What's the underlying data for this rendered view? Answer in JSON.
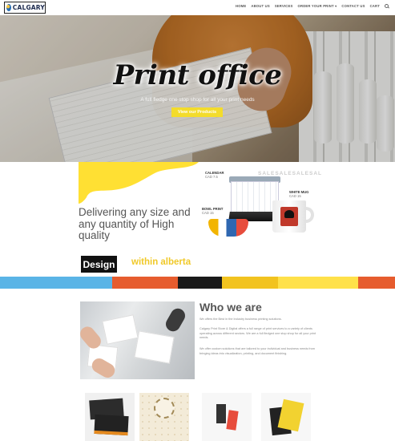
{
  "header": {
    "logo_text": "CALGARY",
    "nav": [
      "HOME",
      "ABOUT US",
      "SERVICES",
      "ORDER YOUR PRINT ▾",
      "CONTACT US",
      "CART"
    ]
  },
  "hero": {
    "title": "Print office",
    "subtitle": "A full fledge one stop shop for all your print needs",
    "button": "View our Products"
  },
  "promo": {
    "heading": "Delivering any size and any quantity of High quality",
    "marquee": "SALESALESALESAL",
    "products": [
      {
        "name": "CALENDAR",
        "price": "CAD 7.5"
      },
      {
        "name": "WHITE MUG",
        "price": "CAD 15"
      },
      {
        "name": "BOWL PRINT",
        "price": "CAD 15"
      }
    ],
    "design_label": "Design",
    "within_label": "within alberta"
  },
  "band_colors": [
    "#5ab4e6",
    "#e65c2e",
    "#1a1a1a",
    "#f2c31f",
    "#ffe14a",
    "#e65c2e"
  ],
  "about": {
    "title": "Who we are",
    "p1": "We offers the Best in the Industry business printing solutions.",
    "p2": "Calgary Print Store & Digital offers a full range of print services to a variety of clients operating across different sectors. We are a full fledged one stop shop for all your print needs.",
    "p3": "We offer custom solutions that are tailored to your individual and business needs from bringing ideas into visualization, printing, and document finishing."
  }
}
